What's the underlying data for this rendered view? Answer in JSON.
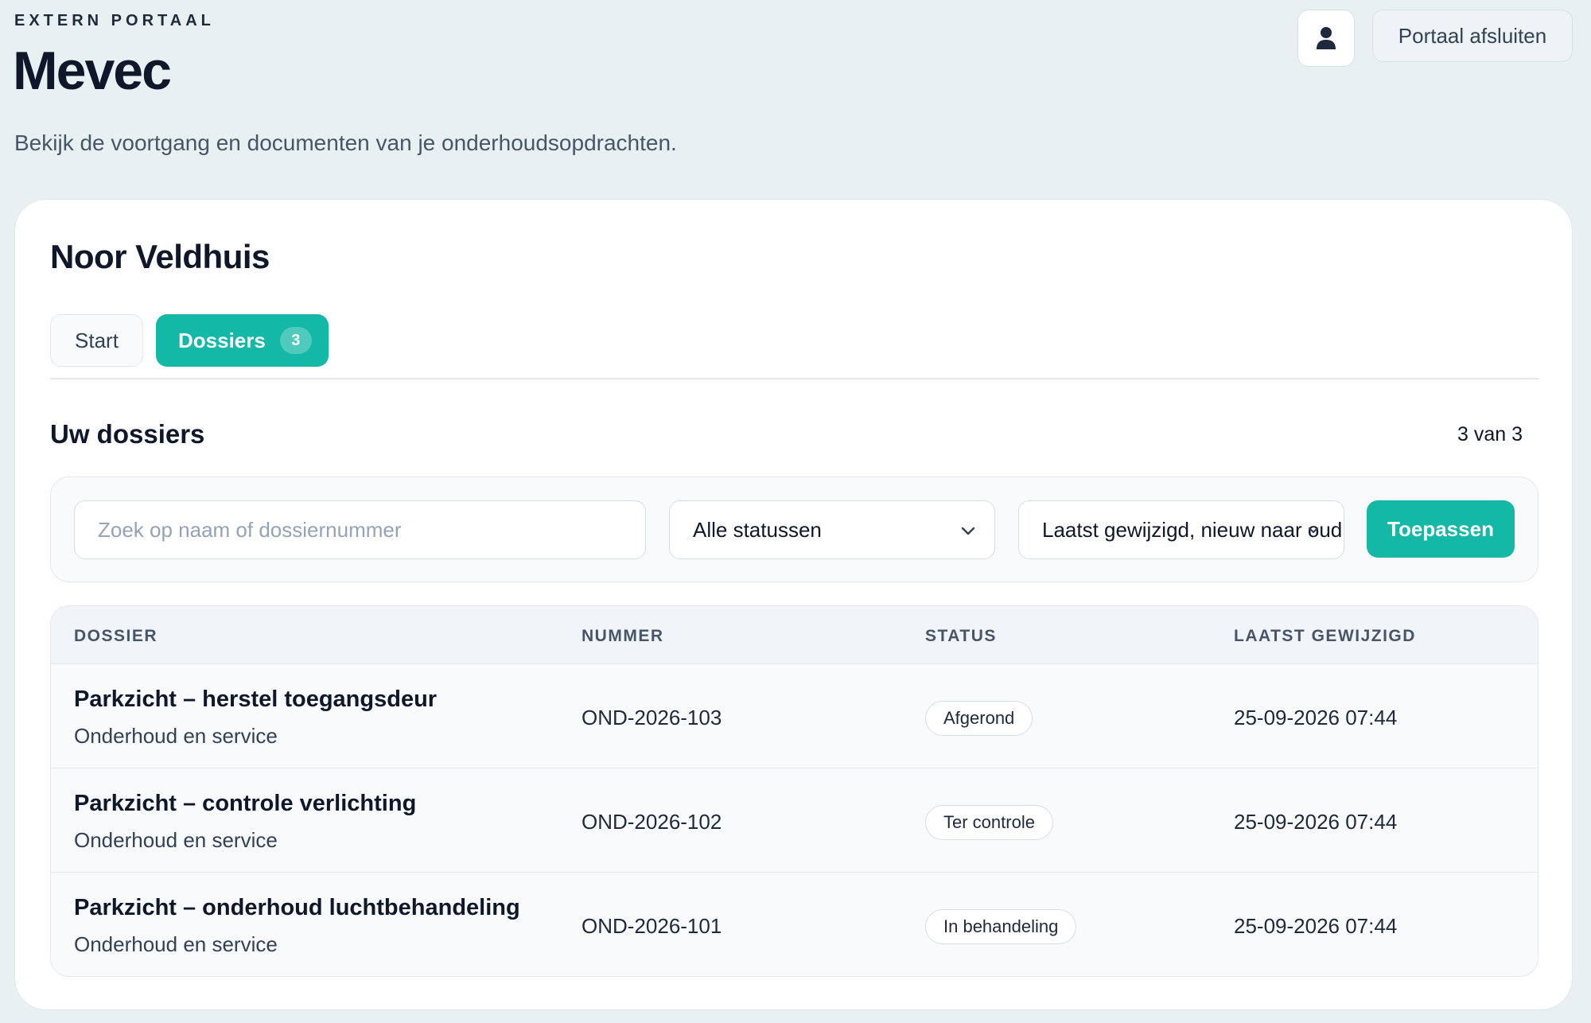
{
  "header": {
    "eyebrow": "EXTERN PORTAAL",
    "brand": "Mevec",
    "intro": "Bekijk de voortgang en documenten van je onderhoudsopdrachten.",
    "exit_label": "Portaal afsluiten",
    "user_icon": "user-icon"
  },
  "card": {
    "person_name": "Noor Veldhuis",
    "tabs": [
      {
        "label": "Start",
        "active": false
      },
      {
        "label": "Dossiers",
        "active": true,
        "count": "3"
      }
    ],
    "section_title": "Uw dossiers",
    "count_text": "3 van 3"
  },
  "filters": {
    "search_placeholder": "Zoek op naam of dossiernummer",
    "status_value": "Alle statussen",
    "sort_value": "Laatst gewijzigd, nieuw naar oud",
    "apply_label": "Toepassen"
  },
  "table": {
    "columns": [
      "DOSSIER",
      "NUMMER",
      "STATUS",
      "LAATST GEWIJZIGD"
    ],
    "rows": [
      {
        "title": "Parkzicht – herstel toegangsdeur",
        "subtitle": "Onderhoud en service",
        "number": "OND-2026-103",
        "status": "Afgerond",
        "modified": "25-09-2026 07:44"
      },
      {
        "title": "Parkzicht – controle verlichting",
        "subtitle": "Onderhoud en service",
        "number": "OND-2026-102",
        "status": "Ter controle",
        "modified": "25-09-2026 07:44"
      },
      {
        "title": "Parkzicht – onderhoud luchtbehandeling",
        "subtitle": "Onderhoud en service",
        "number": "OND-2026-101",
        "status": "In behandeling",
        "modified": "25-09-2026 07:44"
      }
    ]
  },
  "colors": {
    "accent": "#14b8a6",
    "background": "#e8f0f2"
  }
}
